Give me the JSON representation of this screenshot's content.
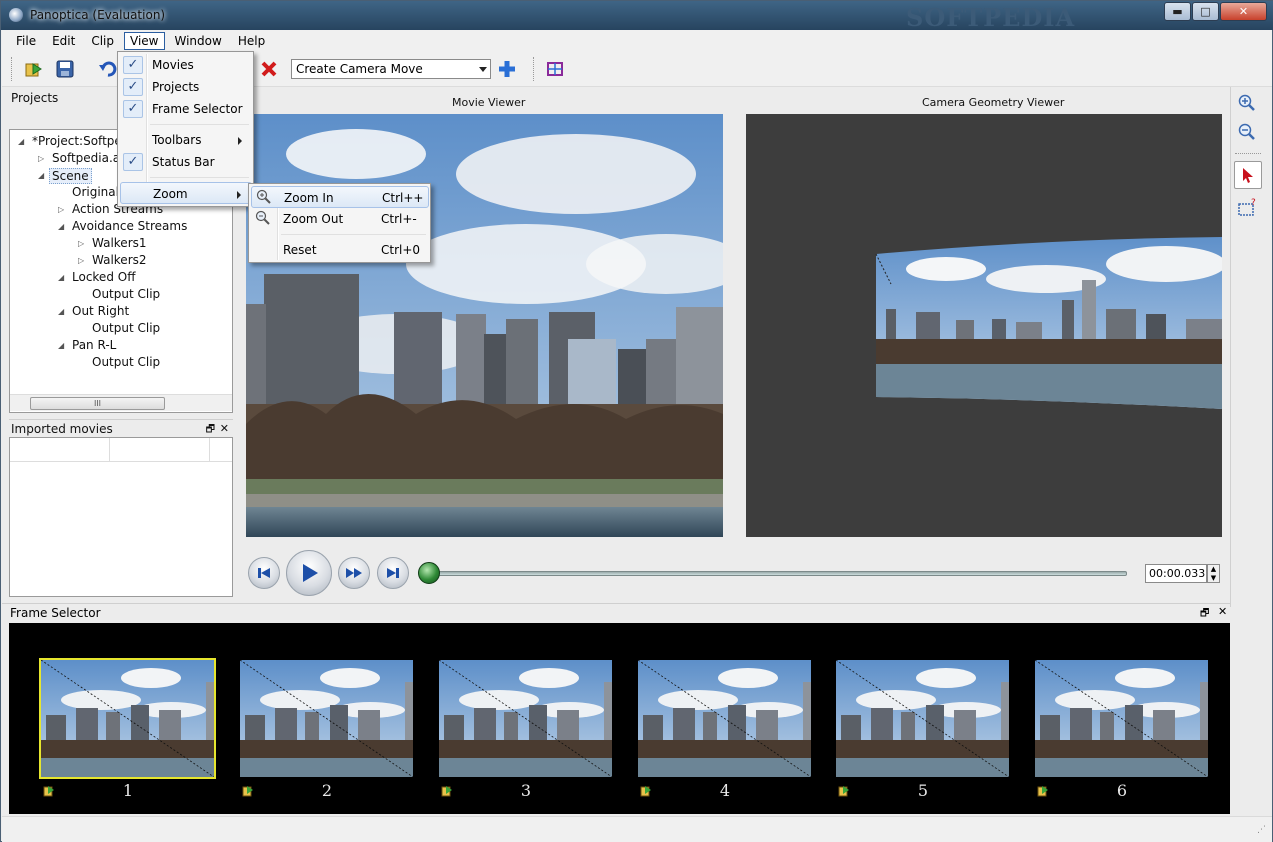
{
  "window": {
    "title": "Panoptica (Evaluation)",
    "watermark": "SOFTPEDIA"
  },
  "caption_buttons": {
    "minimize": "▬",
    "maximize": "□",
    "close": "✕"
  },
  "menubar": [
    "File",
    "Edit",
    "Clip",
    "View",
    "Window",
    "Help"
  ],
  "toolbar": {
    "camera_move_select": "Create Camera Move"
  },
  "projects_panel": {
    "title": "Projects",
    "tree": [
      {
        "label": "*Project:Softped",
        "level": 0,
        "expanded": true
      },
      {
        "label": "Softpedia.av",
        "level": 1,
        "expanded": false
      },
      {
        "label": "Scene",
        "level": 1,
        "expanded": true,
        "selected": true
      },
      {
        "label": "Original",
        "level": 2
      },
      {
        "label": "Action Streams",
        "level": 2,
        "expanded": false
      },
      {
        "label": "Avoidance Streams",
        "level": 2,
        "expanded": true
      },
      {
        "label": "Walkers1",
        "level": 3,
        "expanded": false
      },
      {
        "label": "Walkers2",
        "level": 3,
        "expanded": false
      },
      {
        "label": "Locked Off",
        "level": 2,
        "expanded": true
      },
      {
        "label": "Output Clip",
        "level": 3
      },
      {
        "label": "Out Right",
        "level": 2,
        "expanded": true
      },
      {
        "label": "Output Clip",
        "level": 3
      },
      {
        "label": "Pan R-L",
        "level": 2,
        "expanded": true
      },
      {
        "label": "Output Clip",
        "level": 3
      }
    ],
    "scroll_grip": "III"
  },
  "imported_panel": {
    "title": "Imported movies",
    "restore": "🗗",
    "close": "✕"
  },
  "viewers": {
    "movie": "Movie Viewer",
    "geometry": "Camera Geometry Viewer"
  },
  "playback": {
    "time": "00:00.033",
    "position": 0.0
  },
  "frame_selector": {
    "title": "Frame Selector",
    "restore": "🗗",
    "close": "✕",
    "frames": [
      "1",
      "2",
      "3",
      "4",
      "5",
      "6"
    ],
    "selected": "1"
  },
  "view_menu": {
    "items": [
      {
        "label": "Movies",
        "checked": true
      },
      {
        "label": "Projects",
        "checked": true
      },
      {
        "label": "Frame Selector",
        "checked": true
      },
      {
        "label": "Toolbars",
        "checked": false,
        "submenu": true
      },
      {
        "label": "Status Bar",
        "checked": true
      },
      {
        "label": "Zoom",
        "checked": false,
        "submenu": true,
        "highlighted": true
      }
    ],
    "check_glyph": "✓"
  },
  "zoom_menu": {
    "items": [
      {
        "label": "Zoom In",
        "shortcut": "Ctrl++",
        "icon": "zoom-in-icon"
      },
      {
        "label": "Zoom Out",
        "shortcut": "Ctrl+-",
        "icon": "zoom-out-icon"
      },
      {
        "label": "Reset",
        "shortcut": "Ctrl+0"
      }
    ]
  },
  "colors": {
    "accent": "#2b5ea1",
    "frame_selected": "#e6e62e",
    "geometry_bg": "#3d3d3d"
  }
}
